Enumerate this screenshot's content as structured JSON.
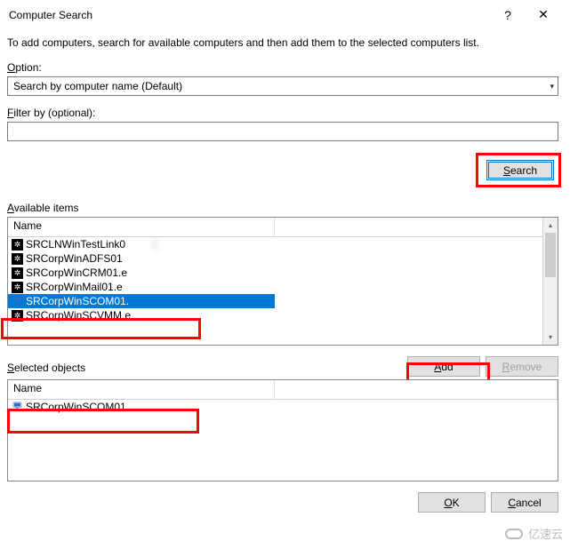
{
  "window": {
    "title": "Computer Search",
    "help_symbol": "?",
    "close_symbol": "✕"
  },
  "description": "To add computers, search for available computers and then add them to the selected computers list.",
  "labels": {
    "option_prefix": "O",
    "option_rest": "ption:",
    "filter_prefix": "F",
    "filter_rest": "ilter by (optional):",
    "available_prefix": "A",
    "available_rest": "vailable items",
    "selected_prefix": "S",
    "selected_rest": "elected objects"
  },
  "option_combo": {
    "selected": "Search by computer name (Default)"
  },
  "filter_value": "",
  "buttons": {
    "search_prefix": "S",
    "search_rest": "earch",
    "add_prefix": "A",
    "add_rest": "dd",
    "remove_prefix": "R",
    "remove_rest": "emove",
    "ok_prefix": "O",
    "ok_rest": "K",
    "cancel_prefix": "C",
    "cancel_rest": "ancel"
  },
  "columns": {
    "name": "Name"
  },
  "available_items": [
    {
      "icon": "gear",
      "text": "SRCLNWinTestLink0",
      "suffix": "s",
      "selected": false
    },
    {
      "icon": "gear",
      "text": "SRCorpWinADFS01",
      "suffix": "",
      "selected": false
    },
    {
      "icon": "gear",
      "text": "SRCorpWinCRM01.e",
      "suffix": "",
      "selected": false
    },
    {
      "icon": "gear",
      "text": "SRCorpWinMail01.e",
      "suffix": "",
      "selected": false
    },
    {
      "icon": "comp",
      "text": "SRCorpWinSCOM01.",
      "suffix": "",
      "selected": true
    },
    {
      "icon": "gear",
      "text": "SRCorpWinSCVMM.e",
      "suffix": "",
      "selected": false
    }
  ],
  "selected_objects": [
    {
      "icon": "comp",
      "text": "SRCorpWinSCOM01",
      "suffix": ""
    }
  ],
  "watermark": "亿速云"
}
